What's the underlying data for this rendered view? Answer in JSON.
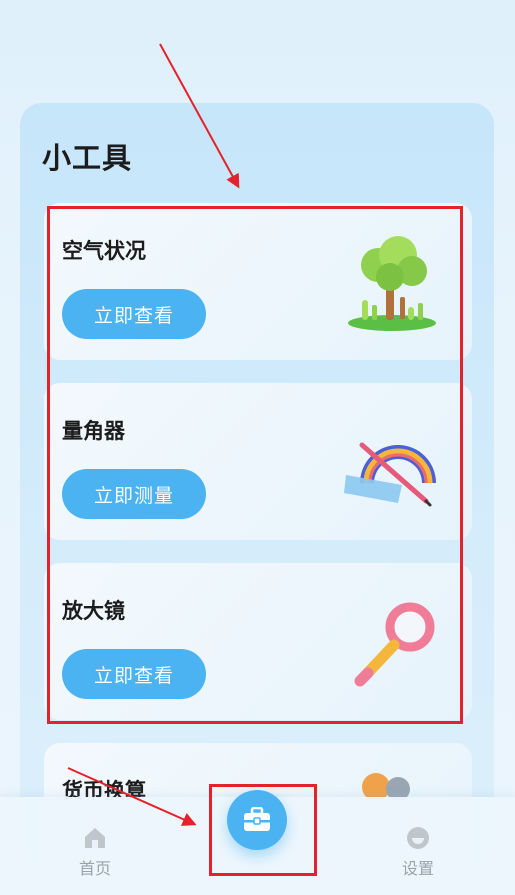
{
  "section": {
    "title": "小工具"
  },
  "cards": [
    {
      "title": "空气状况",
      "button": "立即查看",
      "icon": "tree-icon"
    },
    {
      "title": "量角器",
      "button": "立即测量",
      "icon": "protractor-icon"
    },
    {
      "title": "放大镜",
      "button": "立即查看",
      "icon": "magnifier-icon"
    },
    {
      "title": "货币换算",
      "button": "",
      "icon": "currency-icon"
    }
  ],
  "tabbar": {
    "home_label": "首页",
    "center_icon": "toolbox-icon",
    "settings_label": "设置"
  },
  "colors": {
    "accent": "#4bb3f2",
    "annotation": "#e5222b"
  }
}
